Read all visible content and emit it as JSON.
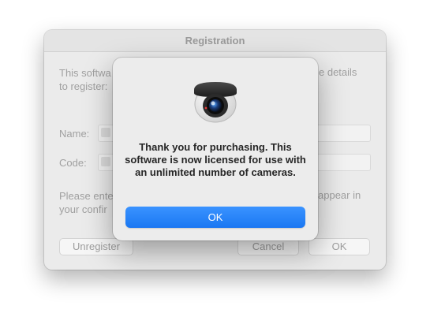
{
  "registration": {
    "title": "Registration",
    "intro_left_line1": "This softwa",
    "intro_left_line2": "to register:",
    "intro_right": "e details",
    "name_label": "Name:",
    "code_label": "Code:",
    "note_left_line1": "Please ente",
    "note_left_line2": "your confir",
    "note_right": "appear in",
    "unregister_label": "Unregister",
    "cancel_label": "Cancel",
    "ok_label": "OK"
  },
  "alert": {
    "icon": "security-camera-icon",
    "message": "Thank you for purchasing. This software is now licensed for use with an unlimited number of cameras.",
    "ok_label": "OK",
    "accent_color": "#1a77f2"
  }
}
